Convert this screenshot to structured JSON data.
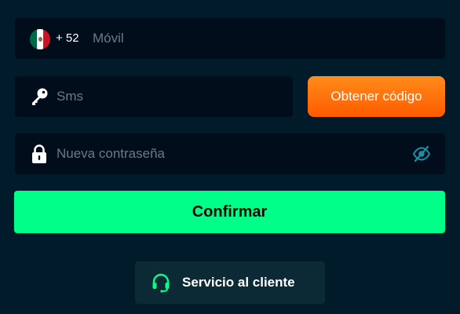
{
  "phone": {
    "prefix": "+ 52",
    "placeholder": "Móvil",
    "flag_icon": "mexico-flag-icon"
  },
  "sms": {
    "placeholder": "Sms",
    "icon": "key-icon",
    "get_code_label": "Obtener código"
  },
  "password": {
    "placeholder": "Nueva contraseña",
    "icon": "lock-icon",
    "toggle_icon": "eye-slash-icon"
  },
  "confirm_label": "Confirmar",
  "support": {
    "label": "Servicio al cliente",
    "icon": "headset-icon"
  },
  "colors": {
    "background": "#021b2a",
    "field": "#010d1b",
    "accent_green": "#00ff88",
    "accent_orange": "#ff6a00",
    "eye_icon": "#1b8fa3"
  }
}
